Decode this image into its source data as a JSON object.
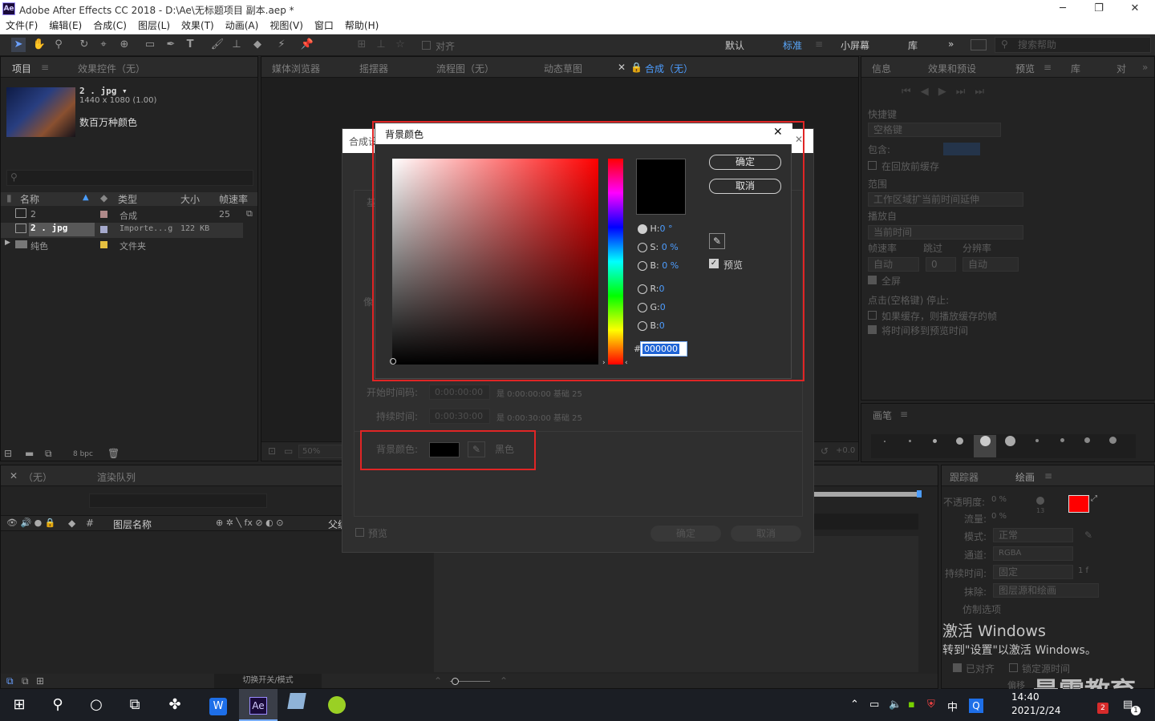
{
  "window": {
    "title": "Adobe After Effects CC 2018 - D:\\Ae\\无标题项目 副本.aep *",
    "logo": "Ae",
    "minimize": "─",
    "restore": "❐",
    "close": "✕"
  },
  "menu": [
    "文件(F)",
    "编辑(E)",
    "合成(C)",
    "图层(L)",
    "效果(T)",
    "动画(A)",
    "视图(V)",
    "窗口",
    "帮助(H)"
  ],
  "toolbar": {
    "align_label": "对齐",
    "workspaces": [
      "默认",
      "标准",
      "小屏幕",
      "库"
    ],
    "active_workspace": "标准",
    "search_placeholder": "搜索帮助"
  },
  "project_panel": {
    "tabs": [
      "项目",
      "效果控件（无）"
    ],
    "preview": {
      "name": "2 . jpg ▾",
      "dims": "1440 x 1080 (1.00)",
      "desc": "数百万种颜色"
    },
    "columns": [
      "名称",
      "类型",
      "大小",
      "帧速率"
    ],
    "rows": [
      {
        "name": "2",
        "type": "合成",
        "size": "",
        "fps": "25",
        "color": "#b08a8a"
      },
      {
        "name": "2 . jpg",
        "type": "Importe...g",
        "size": "122 KB",
        "fps": "",
        "color": "#a5a9cc"
      },
      {
        "name": "纯色",
        "type": "文件夹",
        "size": "",
        "fps": "",
        "color": "#e5c040"
      }
    ],
    "bpc": "8 bpc"
  },
  "center_tabs": [
    "媒体浏览器",
    "摇摆器",
    "流程图（无）",
    "动态草图",
    "合成（无）"
  ],
  "right_panel": {
    "tabs": [
      "信息",
      "效果和预设",
      "预览",
      "库",
      "对"
    ],
    "shortcut_label": "快捷键",
    "shortcut_value": "空格键",
    "include_label": "包含:",
    "cache_before": "在回放前缓存",
    "range_label": "范围",
    "range_value": "工作区域扩当前时间延伸",
    "play_from_label": "播放自",
    "play_from_value": "当前时间",
    "fps_label": "帧速率",
    "skip_label": "跳过",
    "res_label": "分辨率",
    "fps_value": "自动",
    "skip_value": "0",
    "res_value": "自动",
    "fullscreen": "全屏",
    "stop_label": "点击(空格键) 停止:",
    "stop_opt1": "如果缓存，则播放缓存的帧",
    "stop_opt2": "将时间移到预览时间",
    "brushes_tab": "画笔",
    "brush_sizes": [
      "1",
      "3",
      "5",
      "9",
      "13",
      "19",
      "5",
      "9",
      "13",
      "17"
    ]
  },
  "comp_settings": {
    "title": "合成设",
    "start_label": "开始时间码:",
    "start_value": "0:00:00:00",
    "start_note": "是 0:00:00:00  基础 25",
    "dur_label": "持续时间:",
    "dur_value": "0:00:30:00",
    "dur_note": "是 0:00:30:00  基础 25",
    "bg_label": "背景颜色:",
    "bg_name": "黑色",
    "preview": "预览",
    "ok": "确定",
    "cancel": "取消",
    "side_label": "像",
    "basic_tab": "基"
  },
  "color_picker": {
    "title": "背景颜色",
    "close": "✕",
    "ok": "确定",
    "cancel": "取消",
    "preview": "预览",
    "h_label": "H:",
    "h_value": "0 °",
    "s_label": "S:",
    "s_value": "0 %",
    "b_label": "B:",
    "b_value": "0 %",
    "r_label": "R:",
    "r_value": "0",
    "g_label": "G:",
    "g_value": "0",
    "b2_label": "B:",
    "b2_value": "0",
    "hex_label": "#",
    "hex_value": "000000",
    "swatch_color": "#000000"
  },
  "timeline": {
    "tabs": [
      "（无）",
      "渲染队列"
    ],
    "cols": [
      "#",
      "图层名称",
      "父级"
    ],
    "toggle_label": "切换开关/模式",
    "zoom": "50%",
    "exposure": "+0.0"
  },
  "paint_panel": {
    "tabs": [
      "跟踪器",
      "绘画"
    ],
    "opacity_label": "不透明度:",
    "opacity_value": "0 %",
    "flow_label": "流量:",
    "flow_value": "0 %",
    "mode_label": "模式:",
    "mode_value": "正常",
    "channel_label": "通道:",
    "channel_value": "RGBA",
    "duration_label": "持续时间:",
    "duration_value": "固定",
    "duration_extra": "1 f",
    "erase_label": "抹除:",
    "erase_value": "图层源和绘画",
    "clone_label": "仿制选项",
    "aligned": "已对齐",
    "lock_time": "锁定源时间",
    "offset_label": "偏移",
    "fg_color": "#ff0000",
    "bg_color": "#ffffff",
    "brush_size": "13"
  },
  "activation": {
    "line1": "激活 Windows",
    "line2": "转到\"设置\"以激活 Windows。"
  },
  "watermark": "最需教育",
  "taskbar": {
    "time": "14:40",
    "date": "2021/2/24",
    "ime": "中",
    "notif_badge": "2",
    "msg_badge": "1"
  }
}
